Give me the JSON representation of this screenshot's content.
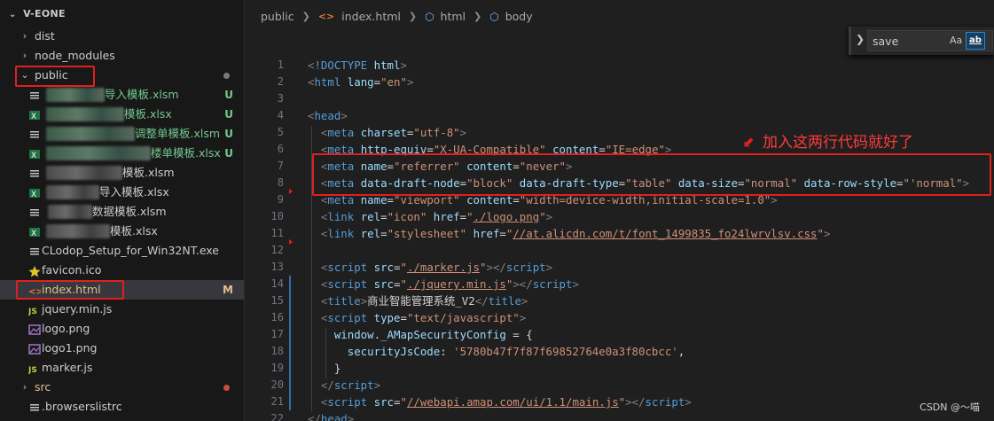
{
  "explorer": {
    "root_label": "V-EONE",
    "items": [
      {
        "label": "dist",
        "kind": "folder",
        "expanded": false
      },
      {
        "label": "node_modules",
        "kind": "folder",
        "expanded": false
      },
      {
        "label": "public",
        "kind": "folder",
        "expanded": true
      },
      {
        "label": "导入模板.xlsm",
        "kind": "excel-m",
        "badge": "U"
      },
      {
        "label": "模板.xlsx",
        "kind": "excel",
        "badge": "U"
      },
      {
        "label": "调整单模板.xlsm",
        "kind": "excel-m",
        "badge": "U"
      },
      {
        "label": "楼单模板.xlsx",
        "kind": "excel",
        "badge": "U"
      },
      {
        "label": "模板.xlsm",
        "kind": "excel-m"
      },
      {
        "label": "导入模板.xlsx",
        "kind": "excel"
      },
      {
        "label": "数据模板.xlsm",
        "kind": "excel-m"
      },
      {
        "label": "模板.xlsx",
        "kind": "excel"
      },
      {
        "label": "CLodop_Setup_for_Win32NT.exe",
        "kind": "exe"
      },
      {
        "label": "favicon.ico",
        "kind": "star"
      },
      {
        "label": "index.html",
        "kind": "html",
        "badge": "M"
      },
      {
        "label": "jquery.min.js",
        "kind": "js"
      },
      {
        "label": "logo.png",
        "kind": "image"
      },
      {
        "label": "logo1.png",
        "kind": "image"
      },
      {
        "label": "marker.js",
        "kind": "js"
      },
      {
        "label": "src",
        "kind": "folder",
        "expanded": false
      },
      {
        "label": ".browserslistrc",
        "kind": "file"
      }
    ]
  },
  "breadcrumb": {
    "folder": "public",
    "file": "index.html",
    "node1": "html",
    "node2": "body"
  },
  "find_widget": {
    "value": "save",
    "match_case": "Aa",
    "whole_word": "ab"
  },
  "annotation": {
    "text": "加入这两行代码就好了"
  },
  "watermark": "CSDN @～喵",
  "colors": {
    "untracked": "#73c991",
    "modified": "#e2c08d",
    "annotation_red": "#e02020"
  },
  "code": {
    "line_numbers": [
      "1",
      "2",
      "3",
      "4",
      "5",
      "6",
      "7",
      "8",
      "9",
      "10",
      "11",
      "12",
      "13",
      "14",
      "15",
      "16",
      "17",
      "18",
      "19",
      "20",
      "21",
      "22"
    ],
    "lines": [
      [
        [
          "tb",
          "<"
        ],
        [
          "t",
          "!DOCTYPE"
        ],
        [
          "w",
          " "
        ],
        [
          "a",
          "html"
        ],
        [
          "tb",
          ">"
        ]
      ],
      [
        [
          "tb",
          "<"
        ],
        [
          "t",
          "html"
        ],
        [
          "w",
          " "
        ],
        [
          "a",
          "lang"
        ],
        [
          "w",
          "="
        ],
        [
          "s",
          "\"en\""
        ],
        [
          "tb",
          ">"
        ]
      ],
      [],
      [
        [
          "tb",
          "<"
        ],
        [
          "t",
          "head"
        ],
        [
          "tb",
          ">"
        ]
      ],
      [
        [
          "w",
          "  "
        ],
        [
          "tb",
          "<"
        ],
        [
          "t",
          "meta"
        ],
        [
          "w",
          " "
        ],
        [
          "a",
          "charset"
        ],
        [
          "w",
          "="
        ],
        [
          "s",
          "\"utf-8\""
        ],
        [
          "tb",
          ">"
        ]
      ],
      [
        [
          "w",
          "  "
        ],
        [
          "tb",
          "<"
        ],
        [
          "t",
          "meta"
        ],
        [
          "w",
          " "
        ],
        [
          "a",
          "http-equiv"
        ],
        [
          "w",
          "="
        ],
        [
          "s",
          "\"X-UA-Compatible\""
        ],
        [
          "w",
          " "
        ],
        [
          "a",
          "content"
        ],
        [
          "w",
          "="
        ],
        [
          "s",
          "\"IE=edge\""
        ],
        [
          "tb",
          ">"
        ]
      ],
      [
        [
          "w",
          "  "
        ],
        [
          "tb",
          "<"
        ],
        [
          "t",
          "meta"
        ],
        [
          "w",
          " "
        ],
        [
          "a",
          "name"
        ],
        [
          "w",
          "="
        ],
        [
          "s",
          "\"referrer\""
        ],
        [
          "w",
          " "
        ],
        [
          "a",
          "content"
        ],
        [
          "w",
          "="
        ],
        [
          "s",
          "\"never\""
        ],
        [
          "tb",
          ">"
        ]
      ],
      [
        [
          "w",
          "  "
        ],
        [
          "tb",
          "<"
        ],
        [
          "t",
          "meta"
        ],
        [
          "w",
          " "
        ],
        [
          "a",
          "data-draft-node"
        ],
        [
          "w",
          "="
        ],
        [
          "s",
          "\"block\""
        ],
        [
          "w",
          " "
        ],
        [
          "a",
          "data-draft-type"
        ],
        [
          "w",
          "="
        ],
        [
          "s",
          "\"table\""
        ],
        [
          "w",
          " "
        ],
        [
          "a",
          "data-size"
        ],
        [
          "w",
          "="
        ],
        [
          "s",
          "\"normal\""
        ],
        [
          "w",
          " "
        ],
        [
          "a",
          "data-row-style"
        ],
        [
          "w",
          "="
        ],
        [
          "s",
          "\"'normal\""
        ],
        [
          "tb",
          ">"
        ]
      ],
      [
        [
          "w",
          "  "
        ],
        [
          "tb",
          "<"
        ],
        [
          "t",
          "meta"
        ],
        [
          "w",
          " "
        ],
        [
          "a",
          "name"
        ],
        [
          "w",
          "="
        ],
        [
          "s",
          "\"viewport\""
        ],
        [
          "w",
          " "
        ],
        [
          "a",
          "content"
        ],
        [
          "w",
          "="
        ],
        [
          "s",
          "\"width=device-width,initial-scale=1.0\""
        ],
        [
          "tb",
          ">"
        ]
      ],
      [
        [
          "w",
          "  "
        ],
        [
          "tb",
          "<"
        ],
        [
          "t",
          "link"
        ],
        [
          "w",
          " "
        ],
        [
          "a",
          "rel"
        ],
        [
          "w",
          "="
        ],
        [
          "s",
          "\"icon\""
        ],
        [
          "w",
          " "
        ],
        [
          "a",
          "href"
        ],
        [
          "w",
          "="
        ],
        [
          "s",
          "\""
        ],
        [
          "su",
          "./logo.png"
        ],
        [
          "s",
          "\""
        ],
        [
          "tb",
          ">"
        ]
      ],
      [
        [
          "w",
          "  "
        ],
        [
          "tb",
          "<"
        ],
        [
          "t",
          "link"
        ],
        [
          "w",
          " "
        ],
        [
          "a",
          "rel"
        ],
        [
          "w",
          "="
        ],
        [
          "s",
          "\"stylesheet\""
        ],
        [
          "w",
          " "
        ],
        [
          "a",
          "href"
        ],
        [
          "w",
          "="
        ],
        [
          "s",
          "\""
        ],
        [
          "su",
          "//at.alicdn.com/t/font_1499835_fo24lwrvlsv.css"
        ],
        [
          "s",
          "\""
        ],
        [
          "tb",
          ">"
        ]
      ],
      [],
      [
        [
          "w",
          "  "
        ],
        [
          "tb",
          "<"
        ],
        [
          "t",
          "script"
        ],
        [
          "w",
          " "
        ],
        [
          "a",
          "src"
        ],
        [
          "w",
          "="
        ],
        [
          "s",
          "\""
        ],
        [
          "su",
          "./marker.js"
        ],
        [
          "s",
          "\""
        ],
        [
          "tb",
          "></"
        ],
        [
          "t",
          "script"
        ],
        [
          "tb",
          ">"
        ]
      ],
      [
        [
          "w",
          "  "
        ],
        [
          "tb",
          "<"
        ],
        [
          "t",
          "script"
        ],
        [
          "w",
          " "
        ],
        [
          "a",
          "src"
        ],
        [
          "w",
          "="
        ],
        [
          "s",
          "\""
        ],
        [
          "su",
          "./jquery.min.js"
        ],
        [
          "s",
          "\""
        ],
        [
          "tb",
          "></"
        ],
        [
          "t",
          "script"
        ],
        [
          "tb",
          ">"
        ]
      ],
      [
        [
          "w",
          "  "
        ],
        [
          "tb",
          "<"
        ],
        [
          "t",
          "title"
        ],
        [
          "tb",
          ">"
        ],
        [
          "w",
          "商业智能管理系统_V2"
        ],
        [
          "tb",
          "</"
        ],
        [
          "t",
          "title"
        ],
        [
          "tb",
          ">"
        ]
      ],
      [
        [
          "w",
          "  "
        ],
        [
          "tb",
          "<"
        ],
        [
          "t",
          "script"
        ],
        [
          "w",
          " "
        ],
        [
          "a",
          "type"
        ],
        [
          "w",
          "="
        ],
        [
          "s",
          "\"text/javascript\""
        ],
        [
          "tb",
          ">"
        ]
      ],
      [
        [
          "w",
          "    "
        ],
        [
          "a",
          "window"
        ],
        [
          "w",
          "."
        ],
        [
          "a",
          "_AMapSecurityConfig"
        ],
        [
          "w",
          " = {"
        ]
      ],
      [
        [
          "w",
          "      "
        ],
        [
          "a",
          "securityJsCode"
        ],
        [
          "w",
          ": "
        ],
        [
          "s",
          "'5780b47f7f87f69852764e0a3f80cbcc'"
        ],
        [
          "w",
          ","
        ]
      ],
      [
        [
          "w",
          "    }"
        ]
      ],
      [
        [
          "w",
          "  "
        ],
        [
          "tb",
          "</"
        ],
        [
          "t",
          "script"
        ],
        [
          "tb",
          ">"
        ]
      ],
      [
        [
          "w",
          "  "
        ],
        [
          "tb",
          "<"
        ],
        [
          "t",
          "script"
        ],
        [
          "w",
          " "
        ],
        [
          "a",
          "src"
        ],
        [
          "w",
          "="
        ],
        [
          "s",
          "\""
        ],
        [
          "su",
          "//webapi.amap.com/ui/1.1/main.js"
        ],
        [
          "s",
          "\""
        ],
        [
          "tb",
          "></"
        ],
        [
          "t",
          "script"
        ],
        [
          "tb",
          ">"
        ]
      ],
      [
        [
          "tb",
          "</"
        ],
        [
          "t",
          "head"
        ],
        [
          "tb",
          ">"
        ]
      ]
    ]
  }
}
